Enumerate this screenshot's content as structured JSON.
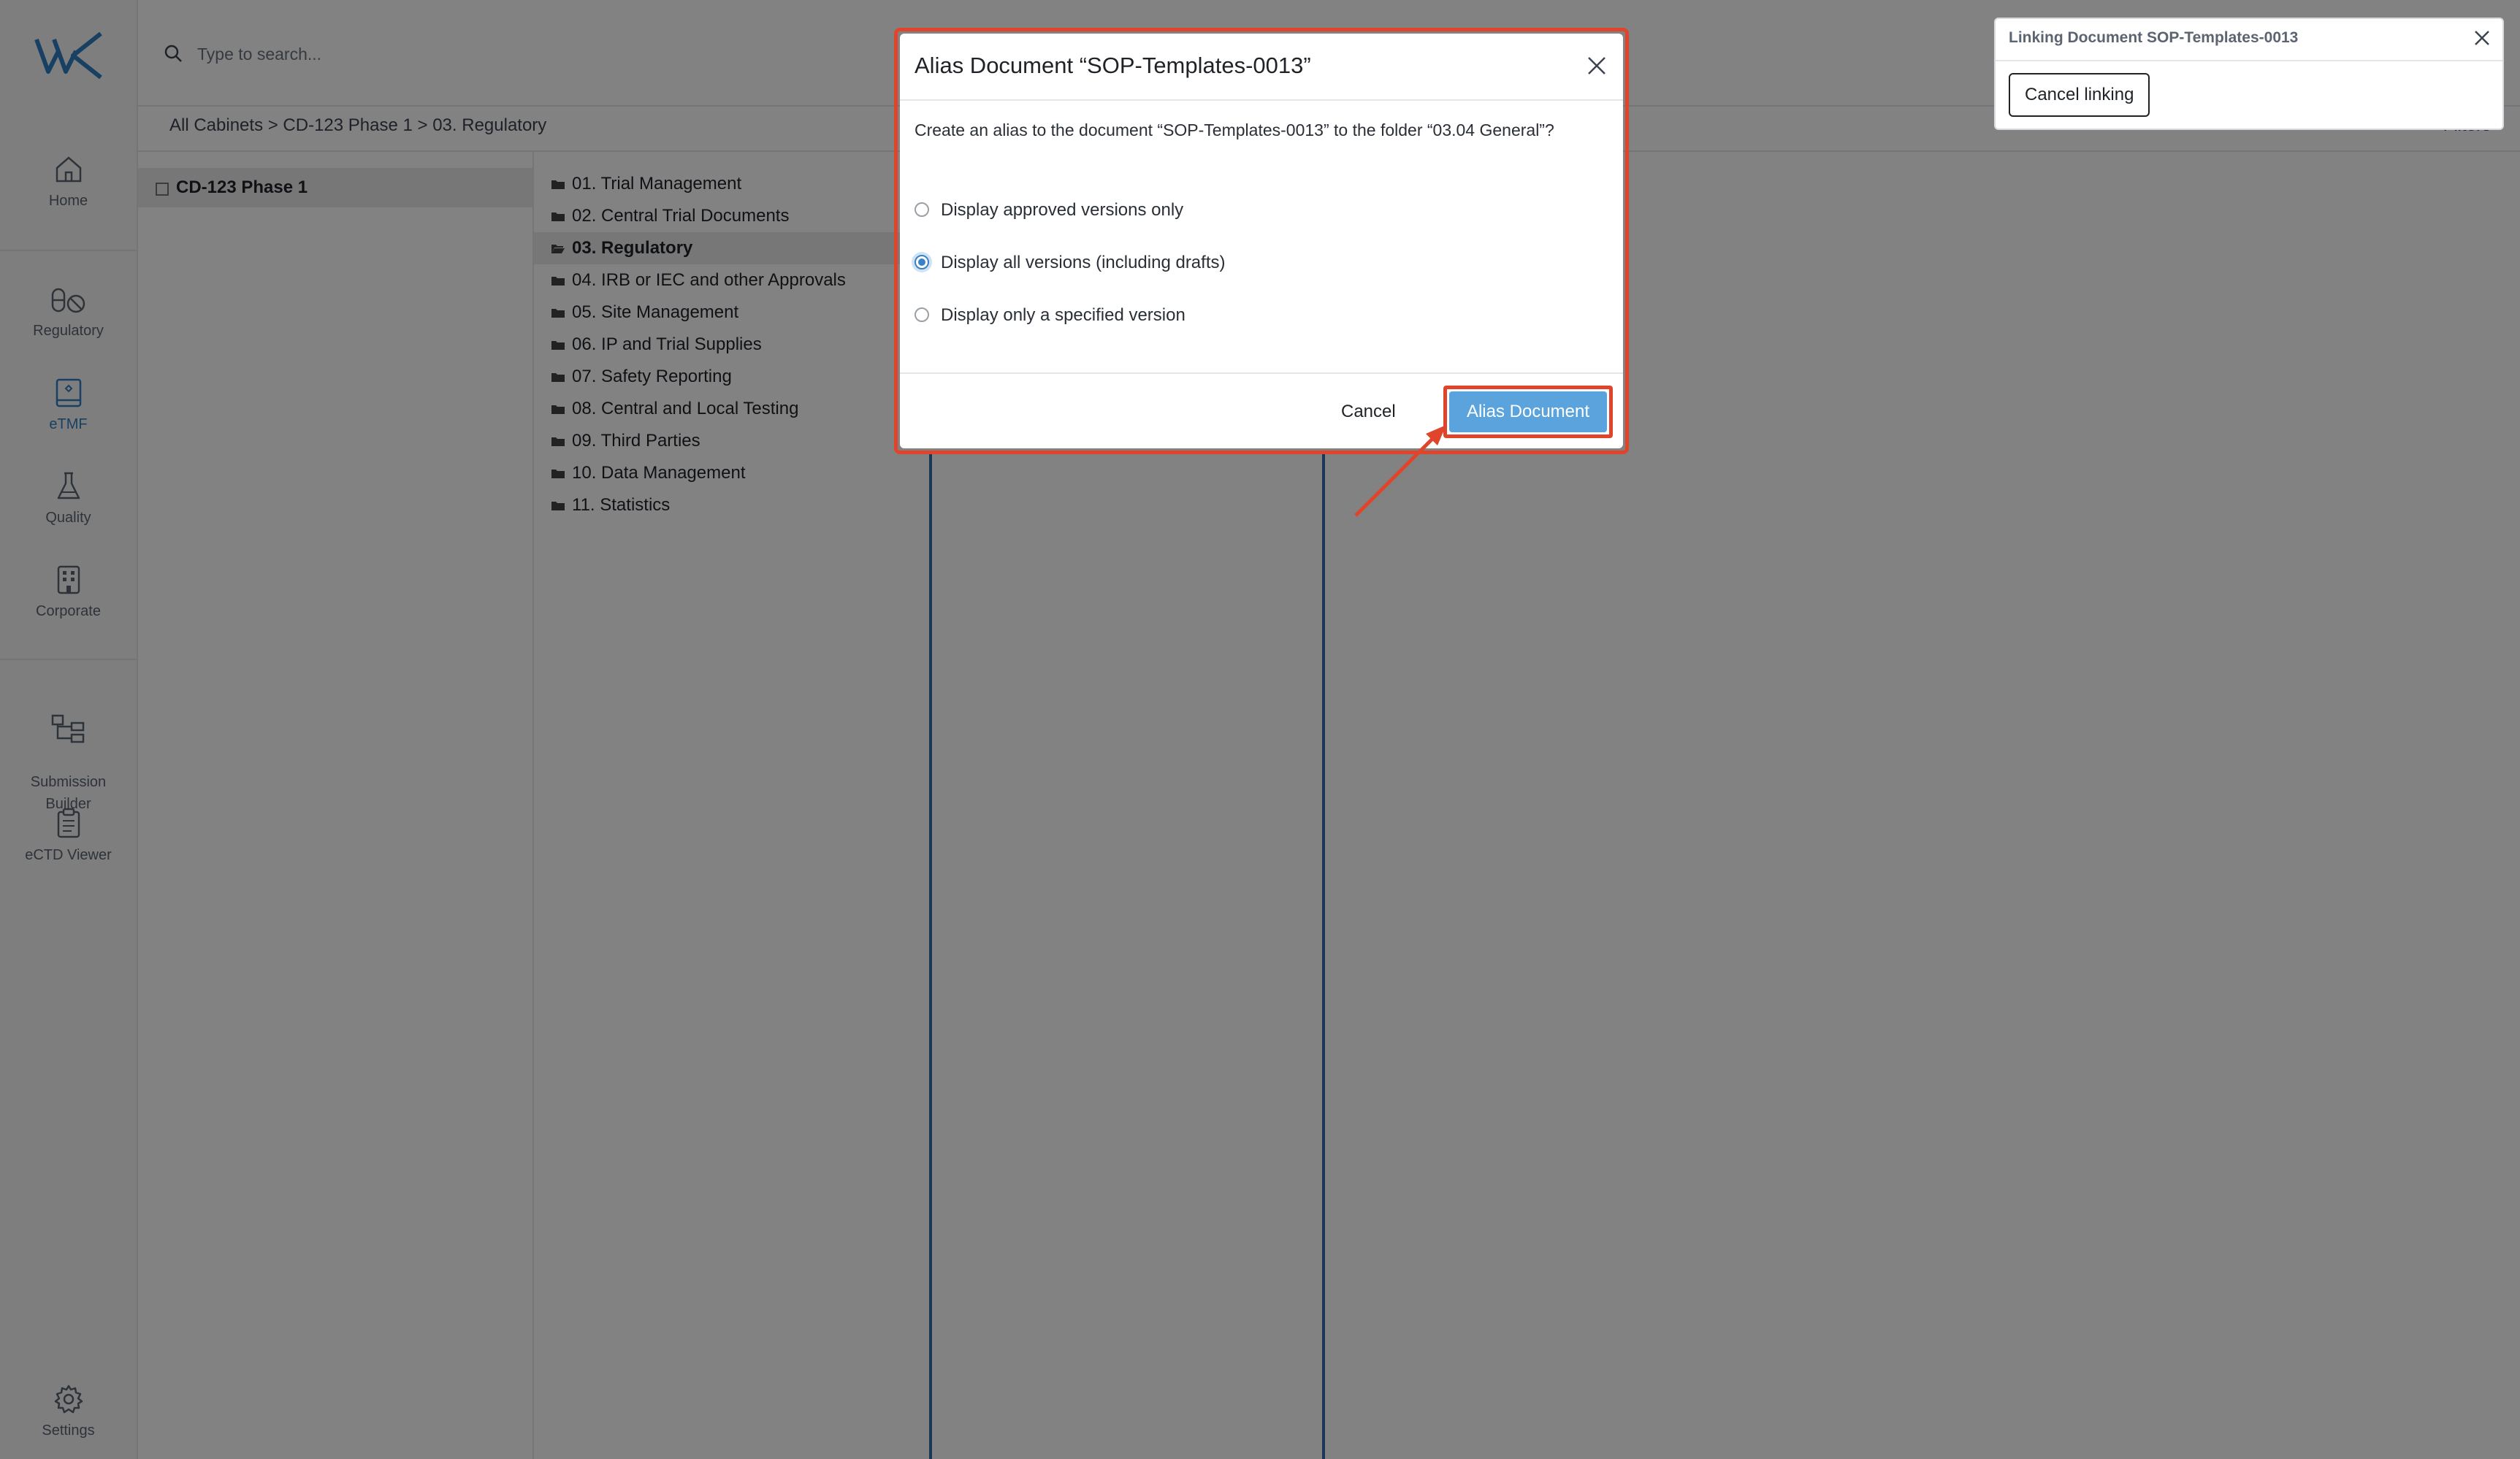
{
  "sidebar": {
    "items": [
      {
        "label": "Home",
        "icon": "home-icon"
      },
      {
        "label": "Regulatory",
        "icon": "pills-icon"
      },
      {
        "label": "eTMF",
        "icon": "etmf-book-icon"
      },
      {
        "label": "Quality",
        "icon": "flask-icon"
      },
      {
        "label": "Corporate",
        "icon": "building-icon"
      },
      {
        "label": "Submission\nBuilder",
        "icon": "hierarchy-icon"
      },
      {
        "label": "eCTD Viewer",
        "icon": "clipboard-icon"
      },
      {
        "label": "Settings",
        "icon": "gear-icon"
      }
    ],
    "active": "eTMF"
  },
  "search": {
    "placeholder": "Type to search..."
  },
  "breadcrumb": "All Cabinets > CD-123 Phase 1 > 03. Regulatory",
  "filters_label": "Filters",
  "tree": {
    "root": "CD-123 Phase 1"
  },
  "folders": [
    "01. Trial Management",
    "02. Central Trial Documents",
    "03. Regulatory",
    "04. IRB or IEC and other Approvals",
    "05. Site Management",
    "06. IP and Trial Supplies",
    "07. Safety Reporting",
    "08. Central and Local Testing",
    "09. Third Parties",
    "10. Data Management",
    "11. Statistics"
  ],
  "active_folder": "03. Regulatory",
  "modal": {
    "title": "Alias Document “SOP-Templates-0013”",
    "body": "Create an alias to the document “SOP-Templates-0013” to the folder “03.04 General”?",
    "options": [
      {
        "label": "Display approved versions only",
        "checked": false
      },
      {
        "label": "Display all versions (including drafts)",
        "checked": true
      },
      {
        "label": "Display only a specified version",
        "checked": false
      }
    ],
    "cancel_label": "Cancel",
    "confirm_label": "Alias Document"
  },
  "toast": {
    "title": "Linking Document SOP-Templates-0013",
    "button_label": "Cancel linking"
  },
  "colors": {
    "accent": "#5aa3dc",
    "highlight": "#e0452b",
    "active_nav": "#2f7fc1"
  }
}
